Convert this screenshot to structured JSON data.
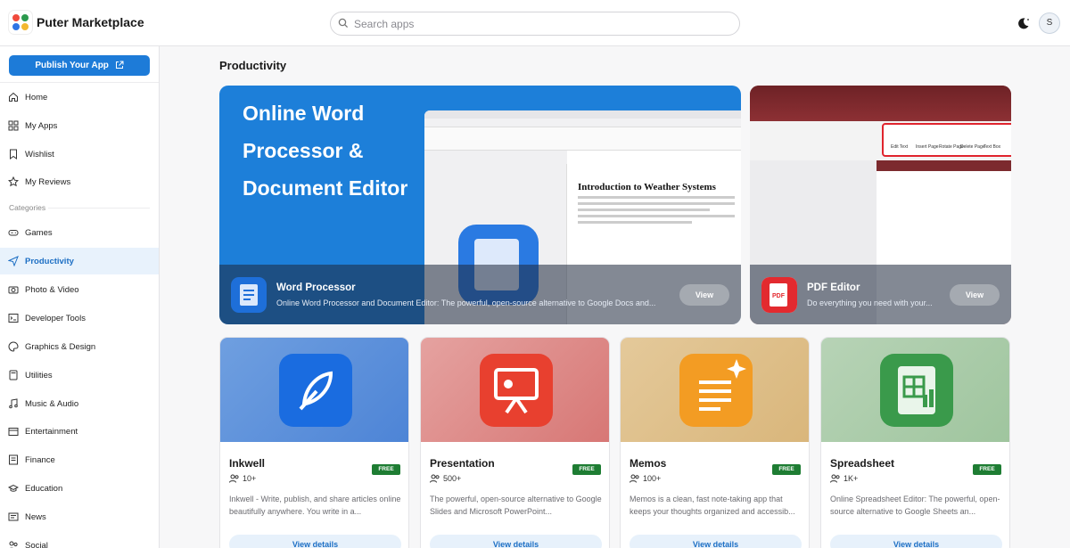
{
  "header": {
    "brand": "Puter Marketplace",
    "search_placeholder": "Search apps",
    "avatar_initial": "S"
  },
  "sidebar": {
    "publish_label": "Publish Your App",
    "categories_label": "Categories",
    "items": [
      {
        "label": "Home",
        "icon": "home-icon"
      },
      {
        "label": "My Apps",
        "icon": "apps-icon"
      },
      {
        "label": "Wishlist",
        "icon": "bookmark-icon"
      },
      {
        "label": "My Reviews",
        "icon": "star-icon"
      }
    ],
    "categories": [
      {
        "label": "Games",
        "icon": "gamepad-icon"
      },
      {
        "label": "Productivity",
        "icon": "send-icon",
        "active": true
      },
      {
        "label": "Photo & Video",
        "icon": "camera-icon"
      },
      {
        "label": "Developer Tools",
        "icon": "terminal-icon"
      },
      {
        "label": "Graphics & Design",
        "icon": "palette-icon"
      },
      {
        "label": "Utilities",
        "icon": "calculator-icon"
      },
      {
        "label": "Music & Audio",
        "icon": "music-icon"
      },
      {
        "label": "Entertainment",
        "icon": "ticket-icon"
      },
      {
        "label": "Finance",
        "icon": "finance-icon"
      },
      {
        "label": "Education",
        "icon": "education-icon"
      },
      {
        "label": "News",
        "icon": "news-icon"
      },
      {
        "label": "Social",
        "icon": "social-icon"
      }
    ]
  },
  "main": {
    "title": "Productivity",
    "featured": [
      {
        "hero_text": "Online Word Processor & Document Editor",
        "name": "Word Processor",
        "description": "Online Word Processor and Document Editor: The powerful, open-source alternative to Google Docs and...",
        "view_label": "View",
        "screen_heading": "Introduction to Weather Systems"
      },
      {
        "name": "PDF Editor",
        "description": "Do everything you need with your...",
        "view_label": "View",
        "toolbar_labels": [
          "Edit Text",
          "Insert Page",
          "Rotate Page",
          "Delete Page",
          "Text Box"
        ]
      }
    ],
    "cards": [
      {
        "name": "Inkwell",
        "badge": "FREE",
        "users": "10+",
        "description": "Inkwell - Write, publish, and share articles online beautifully anywhere. You write in a...",
        "details_label": "View details",
        "icon": "feather-icon"
      },
      {
        "name": "Presentation",
        "badge": "FREE",
        "users": "500+",
        "description": "The powerful, open-source alternative to Google Slides and Microsoft PowerPoint...",
        "details_label": "View details",
        "icon": "presentation-icon"
      },
      {
        "name": "Memos",
        "badge": "FREE",
        "users": "100+",
        "description": "Memos is a clean, fast note-taking app that keeps your thoughts organized and accessib...",
        "details_label": "View details",
        "icon": "memo-icon"
      },
      {
        "name": "Spreadsheet",
        "badge": "FREE",
        "users": "1K+",
        "description": "Online Spreadsheet Editor: The powerful, open-source alternative to Google Sheets an...",
        "details_label": "View details",
        "icon": "spreadsheet-icon"
      }
    ]
  },
  "colors": {
    "accent": "#1d7bd8",
    "free_badge": "#1e7d33",
    "active_bg": "#e8f2fc"
  }
}
